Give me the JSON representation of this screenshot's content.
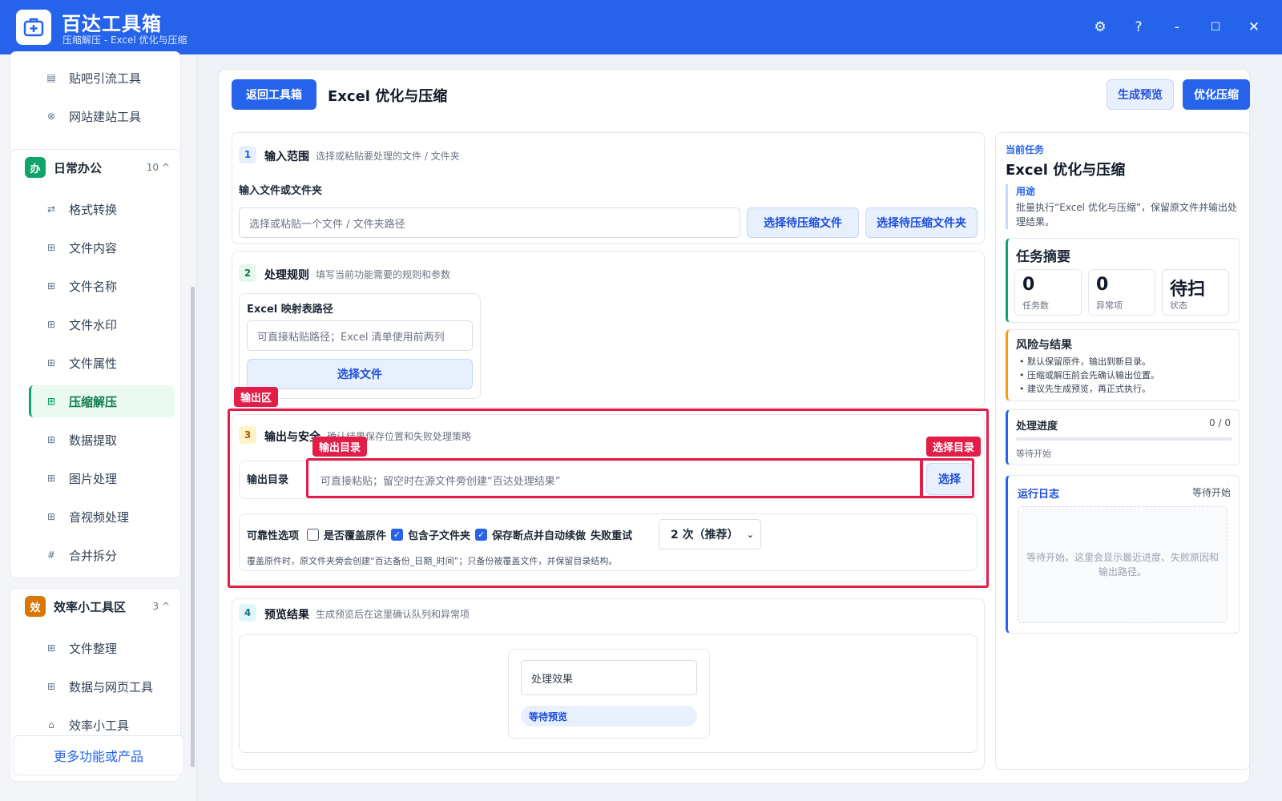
{
  "titlebar": {
    "title": "百达工具箱",
    "subtitle": "压缩解压 - Excel 优化与压缩",
    "controls": {
      "settings": "⚙",
      "help": "?",
      "minimize": "-",
      "maximize": "☐",
      "close": "✕"
    }
  },
  "sidebar": {
    "top_items": [
      {
        "label": "贴吧引流工具",
        "icon": "▤"
      },
      {
        "label": "网站建站工具",
        "icon": "⊗"
      }
    ],
    "group_office": {
      "badge": "办",
      "name": "日常办公",
      "count": "10",
      "caret": "^",
      "items": [
        {
          "label": "格式转换",
          "icon": "⇄"
        },
        {
          "label": "文件内容",
          "icon": "⊞"
        },
        {
          "label": "文件名称",
          "icon": "⊞"
        },
        {
          "label": "文件水印",
          "icon": "⊞"
        },
        {
          "label": "文件属性",
          "icon": "⊞"
        },
        {
          "label": "压缩解压",
          "icon": "⊞"
        },
        {
          "label": "数据提取",
          "icon": "⊞"
        },
        {
          "label": "图片处理",
          "icon": "⊞"
        },
        {
          "label": "音视频处理",
          "icon": "⊞"
        },
        {
          "label": "合并拆分",
          "icon": "#"
        }
      ]
    },
    "group_efficiency": {
      "badge": "效",
      "name": "效率小工具区",
      "count": "3",
      "caret": "^",
      "items": [
        {
          "label": "文件整理",
          "icon": "⊞"
        },
        {
          "label": "数据与网页工具",
          "icon": "⊞"
        },
        {
          "label": "效率小工具",
          "icon": "⌂"
        }
      ]
    },
    "more": "更多功能或产品"
  },
  "header": {
    "back": "返回工具箱",
    "title": "Excel 优化与压缩",
    "preview_btn": "生成预览",
    "run_btn": "优化压缩"
  },
  "step1": {
    "num": "1",
    "title": "输入范围",
    "desc": "选择或粘贴要处理的文件 / 文件夹",
    "field_label": "输入文件或文件夹",
    "placeholder": "选择或粘贴一个文件 / 文件夹路径",
    "btn_file": "选择待压缩文件",
    "btn_folder": "选择待压缩文件夹"
  },
  "step2": {
    "num": "2",
    "title": "处理规则",
    "desc": "填写当前功能需要的规则和参数",
    "map_label": "Excel 映射表路径",
    "map_placeholder": "可直接粘贴路径；Excel 清单使用前两列",
    "choose_file": "选择文件"
  },
  "step3": {
    "num": "3",
    "title": "输出与安全",
    "desc": "确认结果保存位置和失败处理策略",
    "out_label": "输出目录",
    "out_placeholder": "可直接粘贴；留空时在源文件旁创建“百达处理结果”",
    "choose": "选择",
    "reliability": "可靠性选项",
    "opt_overwrite": "是否覆盖原件",
    "opt_subfolder": "包含子文件夹",
    "opt_resume": "保存断点并自动续做",
    "retry_label": "失败重试",
    "retry_value": "2 次（推荐）",
    "note": "覆盖原件时，原文件夹旁会创建“百达备份_日期_时间”；只备份被覆盖文件，并保留目录结构。"
  },
  "annotations": {
    "output_area": "输出区",
    "output_dir": "输出目录",
    "choose_dir": "选择目录"
  },
  "step4": {
    "num": "4",
    "title": "预览结果",
    "desc": "生成预览后在这里确认队列和异常项",
    "effect": "处理效果",
    "waiting": "等待预览"
  },
  "right": {
    "current_task": "当前任务",
    "task_title": "Excel 优化与压缩",
    "purpose_label": "用途",
    "purpose_text": "批量执行“Excel 优化与压缩”，保留原文件并输出处理结果。",
    "summary_title": "任务摘要",
    "stats": [
      {
        "value": "0",
        "label": "任务数"
      },
      {
        "value": "0",
        "label": "异常项"
      },
      {
        "value": "待扫",
        "label": "状态"
      }
    ],
    "risk_title": "风险与结果",
    "risks": [
      "默认保留原件，输出到新目录。",
      "压缩或解压前会先确认输出位置。",
      "建议先生成预览，再正式执行。"
    ],
    "progress_title": "处理进度",
    "progress_value": "0 / 0",
    "progress_fraction": 0,
    "progress_status": "等待开始",
    "log_title": "运行日志",
    "log_status": "等待开始",
    "log_text": "等待开始。这里会显示最近进度、失败原因和输出路径。"
  },
  "colors": {
    "primary": "#2563eb",
    "annotation": "#e11d48",
    "office_badge": "#10a36a",
    "efficiency_badge": "#d97706",
    "active_item": "#10a36a"
  }
}
